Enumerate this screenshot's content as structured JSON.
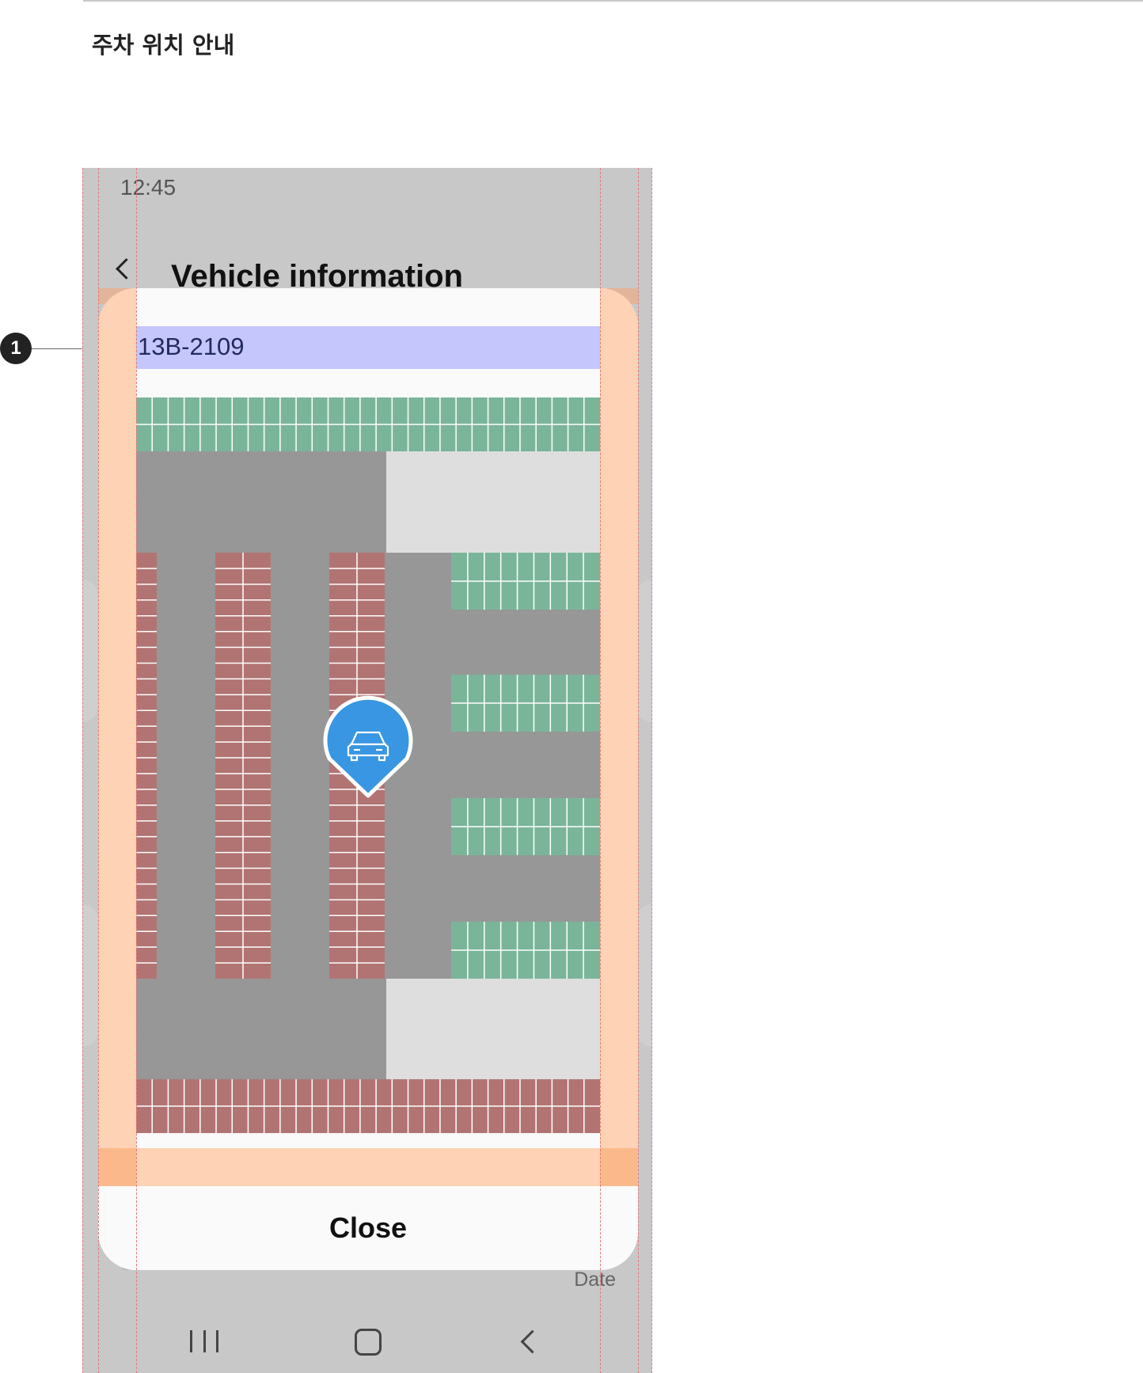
{
  "doc": {
    "title": "주차 위치 안내",
    "callout_number": "1"
  },
  "status_bar": {
    "time": "12:45"
  },
  "app_bar": {
    "title": "Vehicle information"
  },
  "sheet": {
    "plate_number": "13B-2109",
    "close_label": "Close"
  },
  "background_content": {
    "date_label": "Date"
  },
  "map": {
    "colors": {
      "road": "#979797",
      "empty_area": "#dedede",
      "available_space": "#7ab59a",
      "occupied_space": "#b17473",
      "stall_line": "#ffffff",
      "marker": "#3996e2"
    },
    "marker_icon": "car-icon"
  },
  "navbar": {
    "icons": [
      "recents-icon",
      "home-icon",
      "back-icon"
    ]
  }
}
